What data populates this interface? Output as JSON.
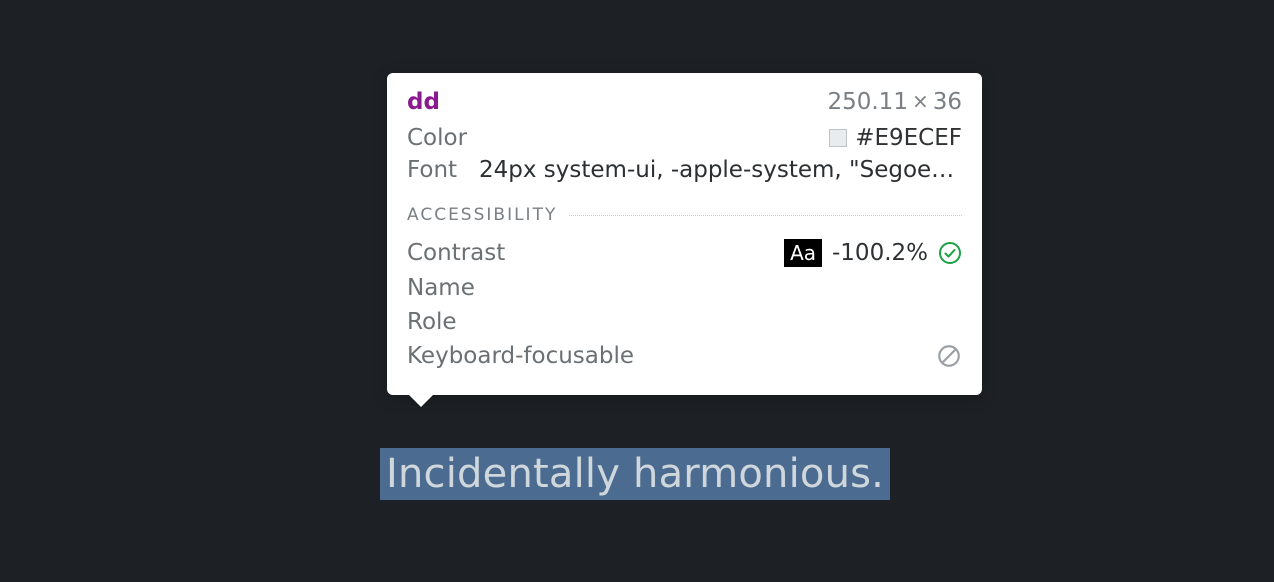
{
  "highlighted_text": "Incidentally harmonious.",
  "tooltip": {
    "tag": "dd",
    "dimensions_w": "250.11",
    "dimensions_h": "36",
    "color_label": "Color",
    "color_value": "#E9ECEF",
    "font_label": "Font",
    "font_value": "24px system-ui, -apple-system, \"Segoe…",
    "accessibility": {
      "section_title": "ACCESSIBILITY",
      "contrast_label": "Contrast",
      "contrast_chip": "Aa",
      "contrast_value": "-100.2%",
      "name_label": "Name",
      "role_label": "Role",
      "keyboard_label": "Keyboard-focusable"
    }
  }
}
